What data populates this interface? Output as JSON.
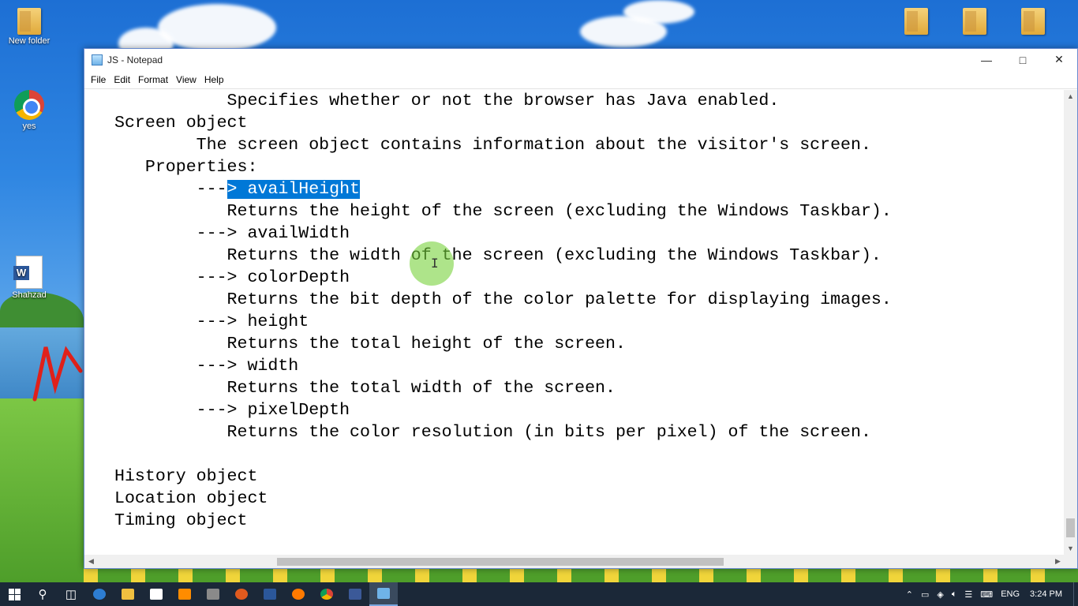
{
  "desktop": {
    "icons": [
      {
        "label": "New folder"
      },
      {
        "label": "yes"
      },
      {
        "label": "Shahzad"
      }
    ]
  },
  "window": {
    "title": "JS - Notepad",
    "controls": {
      "minimize": "—",
      "maximize": "□",
      "close": "✕"
    }
  },
  "menu": {
    "file": "File",
    "edit": "Edit",
    "format": "Format",
    "view": "View",
    "help": "Help"
  },
  "editor": {
    "lines": [
      "           Specifies whether or not the browser has Java enabled.",
      "Screen object",
      "        The screen object contains information about the visitor's screen.",
      "   Properties:",
      "        ---",
      "           Returns the height of the screen (excluding the Windows Taskbar).",
      "        ---> availWidth",
      "           Returns the width of the screen (excluding the Windows Taskbar).",
      "        ---> colorDepth",
      "           Returns the bit depth of the color palette for displaying images.",
      "        ---> height",
      "           Returns the total height of the screen.",
      "        ---> width",
      "           Returns the total width of the screen.",
      "        ---> pixelDepth",
      "           Returns the color resolution (in bits per pixel) of the screen.",
      "",
      "History object",
      "Location object",
      "Timing object"
    ],
    "selected_text": "> availHeight"
  },
  "taskbar": {
    "language": "ENG",
    "time": "3:24 PM",
    "app_colors": [
      "#f0a030",
      "#2d7dd2",
      "#ffffff",
      "#ff8c00",
      "#8a8a8a",
      "#e05a1e",
      "#2b579a",
      "#ff7a00",
      "#db4437",
      "#3b5998",
      "#6fb3e8"
    ]
  }
}
